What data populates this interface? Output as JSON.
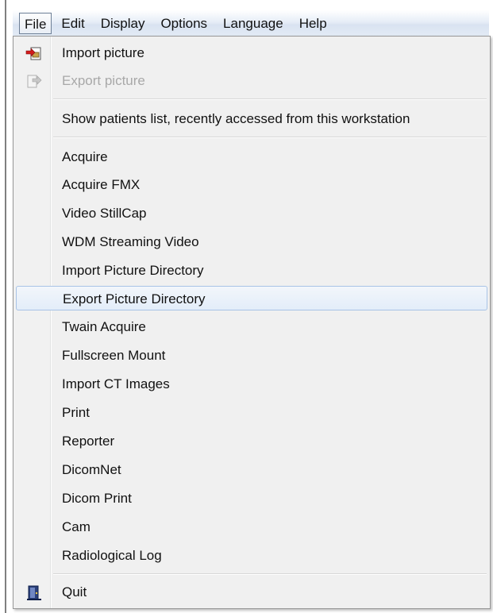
{
  "menubar": {
    "items": [
      "File",
      "Edit",
      "Display",
      "Options",
      "Language",
      "Help"
    ]
  },
  "menu": {
    "import_picture": "Import picture",
    "export_picture": "Export picture",
    "show_patients": "Show patients list, recently accessed from this workstation",
    "acquire": "Acquire",
    "acquire_fmx": "Acquire FMX",
    "video_stillcap": "Video StillCap",
    "wdm_streaming": "WDM Streaming Video",
    "import_picture_directory": "Import Picture Directory",
    "export_picture_directory": "Export Picture Directory",
    "twain_acquire": "Twain Acquire",
    "fullscreen_mount": "Fullscreen Mount",
    "import_ct": "Import CT Images",
    "print": "Print",
    "reporter": "Reporter",
    "dicomnet": "DicomNet",
    "dicom_print": "Dicom Print",
    "cam": "Cam",
    "radiological_log": "Radiological Log",
    "quit": "Quit"
  },
  "colors": {
    "highlight_border": "#a8c3e6",
    "disabled_text": "#a8a8a8"
  }
}
